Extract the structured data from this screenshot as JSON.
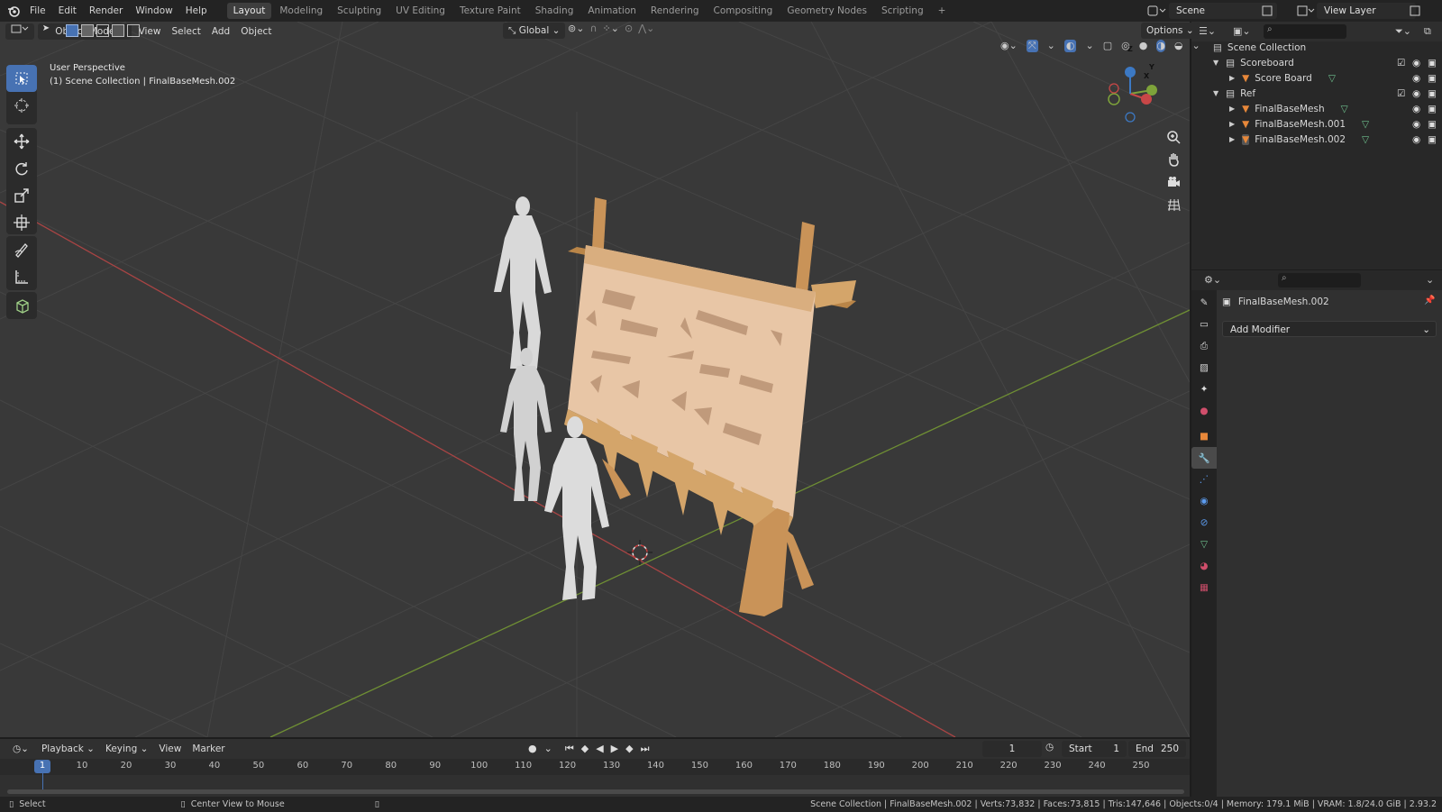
{
  "topbar": {
    "menus": [
      "File",
      "Edit",
      "Render",
      "Window",
      "Help"
    ],
    "workspaces": [
      "Layout",
      "Modeling",
      "Sculpting",
      "UV Editing",
      "Texture Paint",
      "Shading",
      "Animation",
      "Rendering",
      "Compositing",
      "Geometry Nodes",
      "Scripting"
    ],
    "active_workspace": "Layout",
    "add_tab": "+",
    "scene": "Scene",
    "view_layer": "View Layer"
  },
  "viewport_header": {
    "mode": "Object Mode",
    "menus": [
      "View",
      "Select",
      "Add",
      "Object"
    ],
    "orientation": "Global",
    "options": "Options"
  },
  "viewport": {
    "perspective": "User Perspective",
    "collection_line": "(1) Scene Collection | FinalBaseMesh.002",
    "gizmo": {
      "x": "X",
      "y": "Y",
      "z": "Z"
    }
  },
  "tools": [
    "select-box-icon",
    "cursor-icon",
    "move-icon",
    "rotate-icon",
    "scale-icon",
    "transform-icon",
    "annotate-icon",
    "measure-icon",
    "add-cube-icon"
  ],
  "outliner": {
    "root": "Scene Collection",
    "items": [
      {
        "label": "Scoreboard",
        "kind": "collection"
      },
      {
        "label": "Score Board",
        "kind": "object"
      },
      {
        "label": "Ref",
        "kind": "collection"
      },
      {
        "label": "FinalBaseMesh",
        "kind": "object"
      },
      {
        "label": "FinalBaseMesh.001",
        "kind": "object"
      },
      {
        "label": "FinalBaseMesh.002",
        "kind": "object",
        "selected": true
      }
    ]
  },
  "properties": {
    "object_name": "FinalBaseMesh.002",
    "add_modifier": "Add Modifier"
  },
  "timeline": {
    "menus": [
      "Playback",
      "Keying",
      "View",
      "Marker"
    ],
    "current_frame": "1",
    "start_label": "Start",
    "start": "1",
    "end_label": "End",
    "end": "250",
    "ticks": [
      "1",
      "10",
      "20",
      "30",
      "40",
      "50",
      "60",
      "70",
      "80",
      "90",
      "100",
      "110",
      "120",
      "130",
      "140",
      "150",
      "160",
      "170",
      "180",
      "190",
      "200",
      "210",
      "220",
      "230",
      "240",
      "250"
    ]
  },
  "statusbar": {
    "left": "Select",
    "middle": "Center View to Mouse",
    "stats": "Scene Collection | FinalBaseMesh.002 | Verts:73,832 | Faces:73,815 | Tris:147,646 | Objects:0/4 | Memory: 179.1 MiB | VRAM: 1.8/24.0 GiB | 2.93.2"
  },
  "colors": {
    "accent": "#4772b3",
    "board": "#d4a56a",
    "figure": "#d9d9d9",
    "x_axis": "#c84747",
    "y_axis": "#7ea33a"
  }
}
